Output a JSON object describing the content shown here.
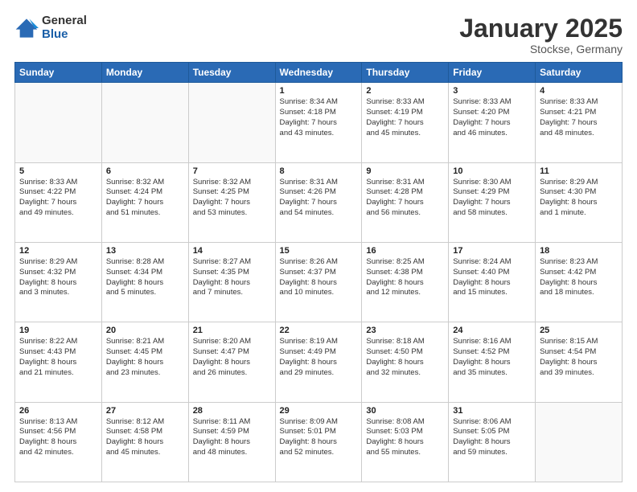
{
  "logo": {
    "general": "General",
    "blue": "Blue"
  },
  "header": {
    "month": "January 2025",
    "location": "Stockse, Germany"
  },
  "weekdays": [
    "Sunday",
    "Monday",
    "Tuesday",
    "Wednesday",
    "Thursday",
    "Friday",
    "Saturday"
  ],
  "weeks": [
    [
      {
        "day": "",
        "info": ""
      },
      {
        "day": "",
        "info": ""
      },
      {
        "day": "",
        "info": ""
      },
      {
        "day": "1",
        "info": "Sunrise: 8:34 AM\nSunset: 4:18 PM\nDaylight: 7 hours\nand 43 minutes."
      },
      {
        "day": "2",
        "info": "Sunrise: 8:33 AM\nSunset: 4:19 PM\nDaylight: 7 hours\nand 45 minutes."
      },
      {
        "day": "3",
        "info": "Sunrise: 8:33 AM\nSunset: 4:20 PM\nDaylight: 7 hours\nand 46 minutes."
      },
      {
        "day": "4",
        "info": "Sunrise: 8:33 AM\nSunset: 4:21 PM\nDaylight: 7 hours\nand 48 minutes."
      }
    ],
    [
      {
        "day": "5",
        "info": "Sunrise: 8:33 AM\nSunset: 4:22 PM\nDaylight: 7 hours\nand 49 minutes."
      },
      {
        "day": "6",
        "info": "Sunrise: 8:32 AM\nSunset: 4:24 PM\nDaylight: 7 hours\nand 51 minutes."
      },
      {
        "day": "7",
        "info": "Sunrise: 8:32 AM\nSunset: 4:25 PM\nDaylight: 7 hours\nand 53 minutes."
      },
      {
        "day": "8",
        "info": "Sunrise: 8:31 AM\nSunset: 4:26 PM\nDaylight: 7 hours\nand 54 minutes."
      },
      {
        "day": "9",
        "info": "Sunrise: 8:31 AM\nSunset: 4:28 PM\nDaylight: 7 hours\nand 56 minutes."
      },
      {
        "day": "10",
        "info": "Sunrise: 8:30 AM\nSunset: 4:29 PM\nDaylight: 7 hours\nand 58 minutes."
      },
      {
        "day": "11",
        "info": "Sunrise: 8:29 AM\nSunset: 4:30 PM\nDaylight: 8 hours\nand 1 minute."
      }
    ],
    [
      {
        "day": "12",
        "info": "Sunrise: 8:29 AM\nSunset: 4:32 PM\nDaylight: 8 hours\nand 3 minutes."
      },
      {
        "day": "13",
        "info": "Sunrise: 8:28 AM\nSunset: 4:34 PM\nDaylight: 8 hours\nand 5 minutes."
      },
      {
        "day": "14",
        "info": "Sunrise: 8:27 AM\nSunset: 4:35 PM\nDaylight: 8 hours\nand 7 minutes."
      },
      {
        "day": "15",
        "info": "Sunrise: 8:26 AM\nSunset: 4:37 PM\nDaylight: 8 hours\nand 10 minutes."
      },
      {
        "day": "16",
        "info": "Sunrise: 8:25 AM\nSunset: 4:38 PM\nDaylight: 8 hours\nand 12 minutes."
      },
      {
        "day": "17",
        "info": "Sunrise: 8:24 AM\nSunset: 4:40 PM\nDaylight: 8 hours\nand 15 minutes."
      },
      {
        "day": "18",
        "info": "Sunrise: 8:23 AM\nSunset: 4:42 PM\nDaylight: 8 hours\nand 18 minutes."
      }
    ],
    [
      {
        "day": "19",
        "info": "Sunrise: 8:22 AM\nSunset: 4:43 PM\nDaylight: 8 hours\nand 21 minutes."
      },
      {
        "day": "20",
        "info": "Sunrise: 8:21 AM\nSunset: 4:45 PM\nDaylight: 8 hours\nand 23 minutes."
      },
      {
        "day": "21",
        "info": "Sunrise: 8:20 AM\nSunset: 4:47 PM\nDaylight: 8 hours\nand 26 minutes."
      },
      {
        "day": "22",
        "info": "Sunrise: 8:19 AM\nSunset: 4:49 PM\nDaylight: 8 hours\nand 29 minutes."
      },
      {
        "day": "23",
        "info": "Sunrise: 8:18 AM\nSunset: 4:50 PM\nDaylight: 8 hours\nand 32 minutes."
      },
      {
        "day": "24",
        "info": "Sunrise: 8:16 AM\nSunset: 4:52 PM\nDaylight: 8 hours\nand 35 minutes."
      },
      {
        "day": "25",
        "info": "Sunrise: 8:15 AM\nSunset: 4:54 PM\nDaylight: 8 hours\nand 39 minutes."
      }
    ],
    [
      {
        "day": "26",
        "info": "Sunrise: 8:13 AM\nSunset: 4:56 PM\nDaylight: 8 hours\nand 42 minutes."
      },
      {
        "day": "27",
        "info": "Sunrise: 8:12 AM\nSunset: 4:58 PM\nDaylight: 8 hours\nand 45 minutes."
      },
      {
        "day": "28",
        "info": "Sunrise: 8:11 AM\nSunset: 4:59 PM\nDaylight: 8 hours\nand 48 minutes."
      },
      {
        "day": "29",
        "info": "Sunrise: 8:09 AM\nSunset: 5:01 PM\nDaylight: 8 hours\nand 52 minutes."
      },
      {
        "day": "30",
        "info": "Sunrise: 8:08 AM\nSunset: 5:03 PM\nDaylight: 8 hours\nand 55 minutes."
      },
      {
        "day": "31",
        "info": "Sunrise: 8:06 AM\nSunset: 5:05 PM\nDaylight: 8 hours\nand 59 minutes."
      },
      {
        "day": "",
        "info": ""
      }
    ]
  ]
}
